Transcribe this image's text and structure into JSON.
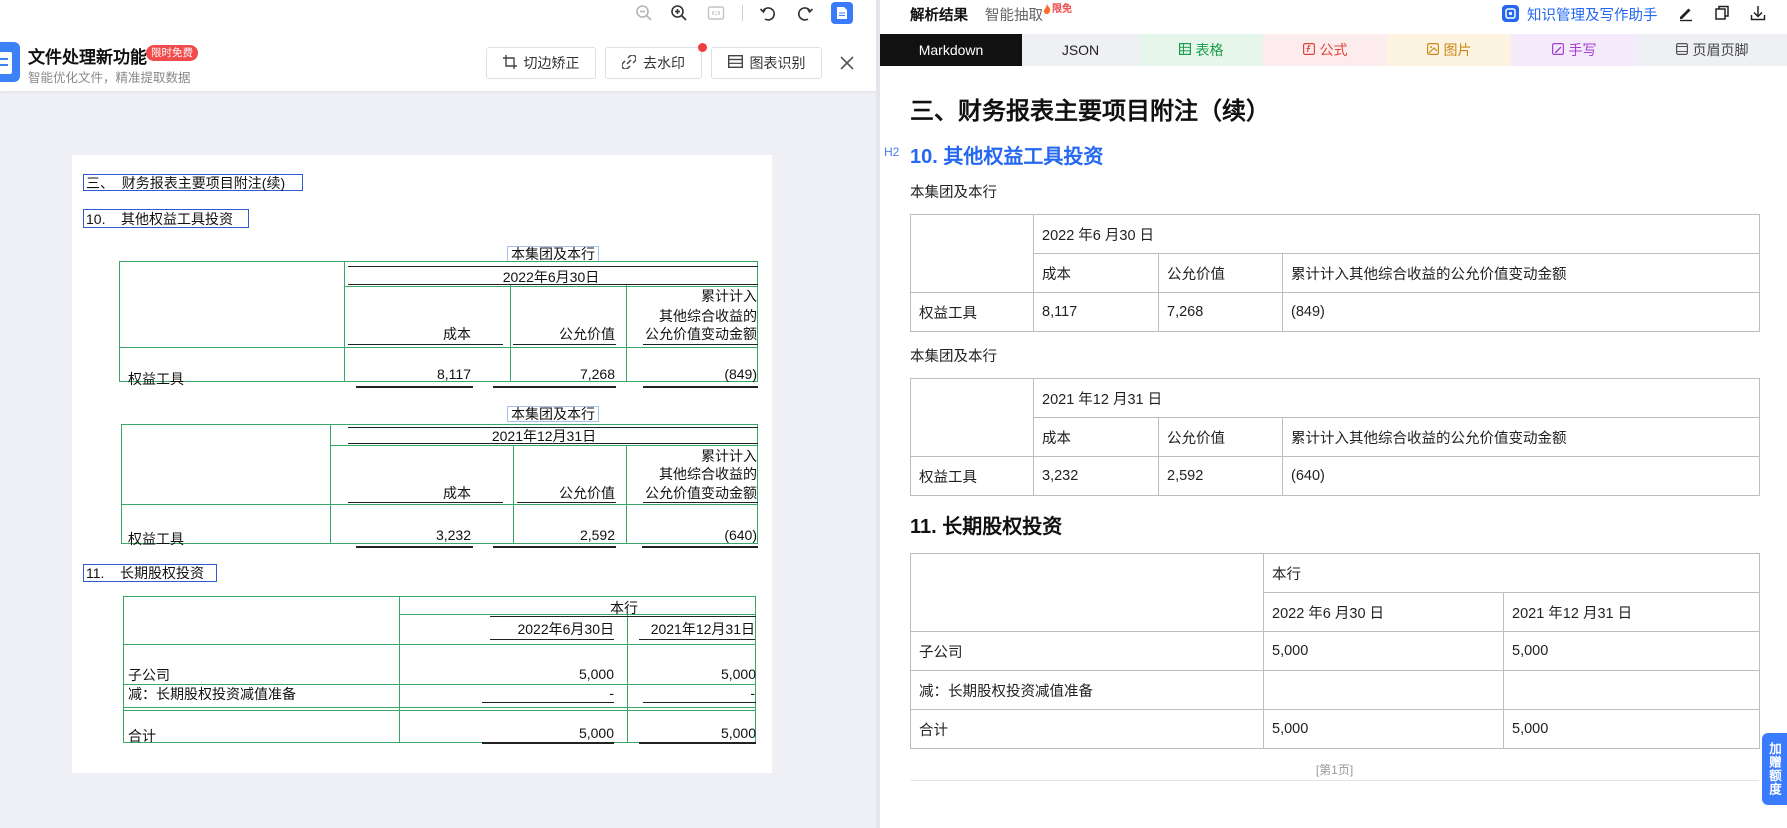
{
  "left_toolbar": {
    "icons": [
      "zoom-out-icon",
      "zoom-in-icon",
      "fit-page-icon",
      "rotate-left-icon",
      "rotate-right-icon",
      "document-view-icon"
    ]
  },
  "header": {
    "title": "文件处理新功能",
    "badge": "限时免费",
    "subtitle": "智能优化文件，精准提取数据",
    "buttons": [
      {
        "label": "切边矫正",
        "icon": "crop-icon"
      },
      {
        "label": "去水印",
        "icon": "watermark-icon"
      },
      {
        "label": "图表识别",
        "icon": "chart-icon"
      }
    ],
    "close_icon": "close-icon"
  },
  "doc": {
    "section_title": "三、  财务报表主要项目附注(续)",
    "note10_title": "10.    其他权益工具投资",
    "t1": {
      "scope": "本集团及本行",
      "date": "2022年6月30日",
      "col_cost": "成本",
      "col_fair": "公允价值",
      "col_cum": [
        "累计计入",
        "其他综合收益的",
        "公允价值变动金额"
      ],
      "row_label": "权益工具",
      "values": [
        "8,117",
        "7,268",
        "(849)"
      ]
    },
    "t2": {
      "scope": "本集团及本行",
      "date": "2021年12月31日",
      "col_cost": "成本",
      "col_fair": "公允价值",
      "col_cum": [
        "累计计入",
        "其他综合收益的",
        "公允价值变动金额"
      ],
      "row_label": "权益工具",
      "values": [
        "3,232",
        "2,592",
        "(640)"
      ]
    },
    "note11_title": "11.    长期股权投资",
    "t3": {
      "scope": "本行",
      "dates": [
        "2022年6月30日",
        "2021年12月31日"
      ],
      "rows": [
        {
          "label": "子公司",
          "values": [
            "5,000",
            "5,000"
          ]
        },
        {
          "label": "减：长期股权投资减值准备",
          "values": [
            "-",
            "-"
          ]
        },
        {
          "label": "合计",
          "values": [
            "5,000",
            "5,000"
          ]
        }
      ]
    }
  },
  "result": {
    "top_tabs": {
      "active": "解析结果",
      "other": "智能抽取",
      "badge": "限免",
      "assistant": "知识管理及写作助手"
    },
    "format_tabs": [
      "Markdown",
      "JSON",
      "表格",
      "公式",
      "图片",
      "手写",
      "页眉页脚"
    ],
    "active_format": "Markdown",
    "h1": "三、财务报表主要项目附注（续）",
    "h2_tag": "H2",
    "h2": "10. 其他权益工具投资",
    "para1": "本集团及本行",
    "table_a": {
      "date": "2022 年6 月30 日",
      "headers": [
        "成本",
        "公允价值",
        "累计计入其他综合收益的公允价值变动金额"
      ],
      "row": [
        "权益工具",
        "8,117",
        "7,268",
        "(849)"
      ]
    },
    "para2": "本集团及本行",
    "table_b": {
      "date": "2021 年12 月31 日",
      "headers": [
        "成本",
        "公允价值",
        "累计计入其他综合收益的公允价值变动金额"
      ],
      "row": [
        "权益工具",
        "3,232",
        "2,592",
        "(640)"
      ]
    },
    "h3": "11. 长期股权投资",
    "table_c": {
      "scope": "本行",
      "dates": [
        "2022 年6 月30 日",
        "2021 年12 月31 日"
      ],
      "rows": [
        [
          "子公司",
          "5,000",
          "5,000"
        ],
        [
          "减：长期股权投资减值准备"
        ],
        [
          "合计",
          "5,000",
          "5,000"
        ]
      ]
    },
    "page_marker": "[第1页]"
  },
  "float_button": "加赠额度",
  "colors": {
    "accent": "#2468f2",
    "badge_red": "#f04a4a",
    "detect_box_blue": "#2f5bd0",
    "table_line_green": "#3aa665",
    "active_tab_bg": "#111111"
  }
}
